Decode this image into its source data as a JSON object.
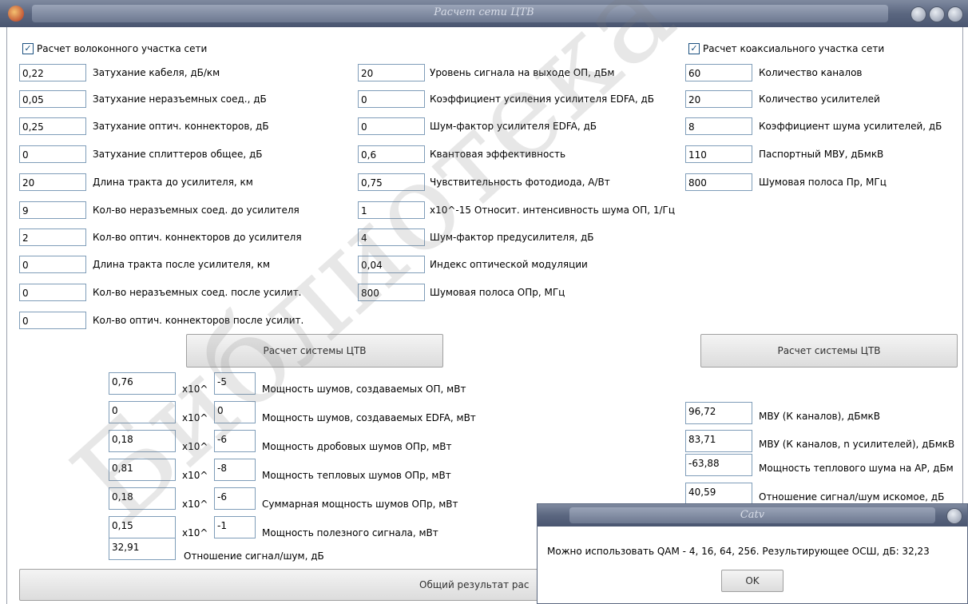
{
  "window": {
    "title": "Расчет сети ЦТВ"
  },
  "fiber": {
    "checkbox_label": "Расчет волоконного участка сети",
    "checkbox_mark": "✓",
    "col1": [
      {
        "value": "0,22",
        "label": "Затухание кабеля, дБ/км"
      },
      {
        "value": "0,05",
        "label": "Затухание неразъемных соед., дБ"
      },
      {
        "value": "0,25",
        "label": "Затухание оптич. коннекторов, дБ"
      },
      {
        "value": "0",
        "label": "Затухание сплиттеров общее, дБ"
      },
      {
        "value": "20",
        "label": "Длина тракта до усилителя, км"
      },
      {
        "value": "9",
        "label": "Кол-во неразъемных соед. до усилителя"
      },
      {
        "value": "2",
        "label": "Кол-во оптич. коннекторов до усилителя"
      },
      {
        "value": "0",
        "label": "Длина тракта после усилителя, км"
      },
      {
        "value": "0",
        "label": "Кол-во неразъемных соед. после усилит."
      },
      {
        "value": "0",
        "label": "Кол-во оптич. коннекторов после усилит."
      }
    ],
    "col2": [
      {
        "value": "20",
        "label": "Уровень сигнала на выходе ОП, дБм"
      },
      {
        "value": "0",
        "label": "Коэффициент усиления усилителя EDFA, дБ"
      },
      {
        "value": "0",
        "label": "Шум-фактор усилителя EDFA, дБ"
      },
      {
        "value": "0,6",
        "label": "Квантовая эффективность"
      },
      {
        "value": "0,75",
        "label": "Чувствительность фотодиода, А/Вт"
      },
      {
        "value": "1",
        "label": "x10^-15 Относит. интенсивность шума ОП, 1/Гц"
      },
      {
        "value": "4",
        "label": "Шум-фактор предусилителя, дБ"
      },
      {
        "value": "0,04",
        "label": "Индекс оптической модуляции"
      },
      {
        "value": "800",
        "label": "Шумовая полоса ОПр, МГц"
      }
    ],
    "calc_button": "Расчет системы ЦТВ",
    "results": [
      {
        "mantissa": "0,76",
        "exp": "-5",
        "label": "Мощность шумов, создаваемых ОП,  мВт"
      },
      {
        "mantissa": "0",
        "exp": "0",
        "label": "Мощность шумов, создаваемых EDFA, мВт"
      },
      {
        "mantissa": "0,18",
        "exp": "-6",
        "label": "Мощность дробовых шумов ОПр, мВт"
      },
      {
        "mantissa": "0,81",
        "exp": "-8",
        "label": "Мощность тепловых шумов ОПр, мВт"
      },
      {
        "mantissa": "0,18",
        "exp": "-6",
        "label": "Суммарная мощность шумов ОПр, мВт"
      },
      {
        "mantissa": "0,15",
        "exp": "-1",
        "label": "Мощность полезного сигнала, мВт"
      }
    ],
    "x10_label": "x10^",
    "snr": {
      "value": "32,91",
      "label": "Отношение сигнал/шум, дБ"
    }
  },
  "coax": {
    "checkbox_label": "Расчет коаксиального участка сети",
    "checkbox_mark": "✓",
    "inputs": [
      {
        "value": "60",
        "label": "Количество каналов"
      },
      {
        "value": "20",
        "label": "Количество усилителей"
      },
      {
        "value": "8",
        "label": "Коэффициент шума усилителей, дБ"
      },
      {
        "value": "110",
        "label": "Паспортный МВУ, дБмкВ"
      },
      {
        "value": "800",
        "label": "Шумовая полоса Пр, МГц"
      }
    ],
    "calc_button": "Расчет системы ЦТВ",
    "results": [
      {
        "value": "96,72",
        "label": "МВУ (К каналов), дБмкВ"
      },
      {
        "value": "83,71",
        "label": "МВУ (К каналов, n усилителей), дБмкВ"
      },
      {
        "value": "-63,88",
        "label": "Мощность теплового шума на АР, дБм"
      },
      {
        "value": "40,59",
        "label": "Отношение сигнал/шум искомое, дБ"
      }
    ]
  },
  "overall_button": "Общий результат рас",
  "dialog": {
    "title": "Catv",
    "message": "Можно использовать QAM - 4, 16, 64, 256. Результирующее ОСШ, дБ: 32,23",
    "ok": "OK"
  },
  "watermark": "Библиотека"
}
